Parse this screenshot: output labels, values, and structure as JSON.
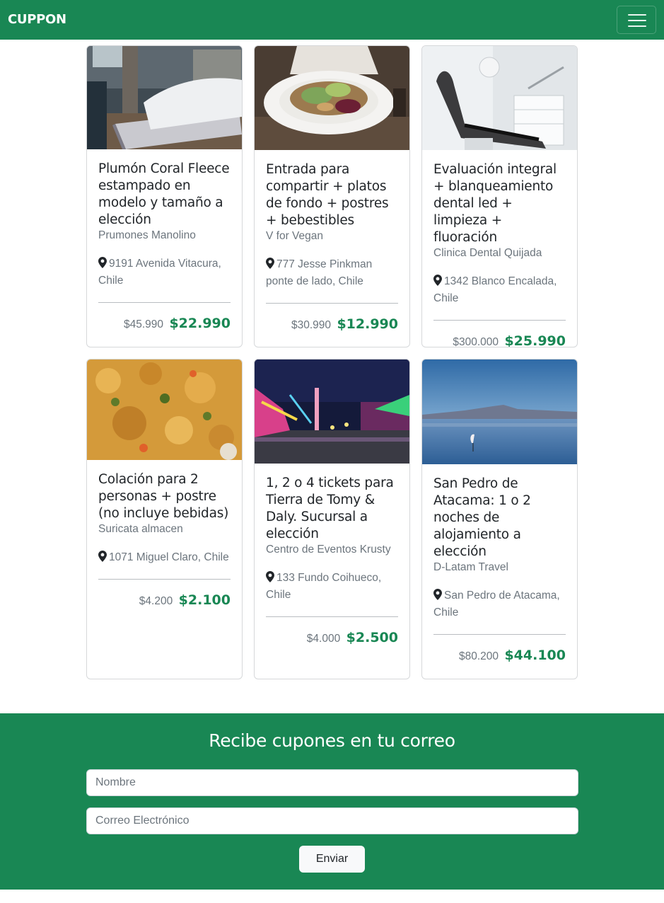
{
  "navbar": {
    "brand": "CUPPON"
  },
  "coupons": [
    {
      "title": "Plumón Coral Fleece estampado en modelo y tamaño a elección",
      "merchant": "Prumones Manolino",
      "address": "9191 Avenida Vitacura, Chile",
      "old_price": "$45.990",
      "new_price": "$22.990",
      "image": "bedroom-photo"
    },
    {
      "title": "Entrada para compartir + platos de fondo + postres + bebestibles",
      "merchant": "V for Vegan",
      "address": "777 Jesse Pinkman ponte de lado, Chile",
      "old_price": "$30.990",
      "new_price": "$12.990",
      "image": "vegan-salad-photo"
    },
    {
      "title": "Evaluación integral + blanqueamiento dental led + limpieza + fluoración",
      "merchant": "Clinica Dental Quijada",
      "address": "1342 Blanco Encalada, Chile",
      "old_price": "$300.000",
      "new_price": "$25.990",
      "image": "dental-chair-photo"
    },
    {
      "title": "Colación para 2 personas + postre (no incluye bebidas)",
      "merchant": "Suricata almacen",
      "address": "1071 Miguel Claro, Chile",
      "old_price": "$4.200",
      "new_price": "$2.100",
      "image": "lentil-stew-photo"
    },
    {
      "title": "1, 2 o 4 tickets para Tierra de Tomy & Daly. Sucursal a elección",
      "merchant": "Centro de Eventos Krusty",
      "address": "133 Fundo Coihueco, Chile",
      "old_price": "$4.000",
      "new_price": "$2.500",
      "image": "fair-rides-photo"
    },
    {
      "title": "San Pedro de Atacama: 1 o 2 noches de alojamiento a elección",
      "merchant": "D-Latam Travel",
      "address": "San Pedro de Atacama, Chile",
      "old_price": "$80.200",
      "new_price": "$44.100",
      "image": "flamingo-lagoon-photo"
    }
  ],
  "newsletter": {
    "title": "Recibe cupones en tu correo",
    "name_placeholder": "Nombre",
    "email_placeholder": "Correo Electrónico",
    "submit_label": "Enviar"
  },
  "colors": {
    "brand_green": "#198754",
    "muted_text": "#6c757d"
  }
}
